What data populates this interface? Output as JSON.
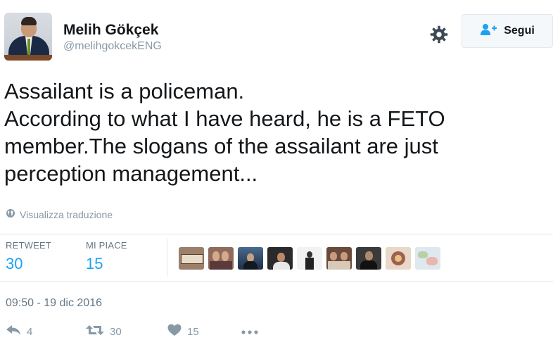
{
  "header": {
    "display_name": "Melih Gökçek",
    "handle": "@melihgokcekENG",
    "follow_label": "Segui"
  },
  "tweet": {
    "lines": [
      "Assailant is a policeman.",
      "According to what I have heard, he is a FETO",
      "member.The slogans of the assailant are just",
      "perception management..."
    ],
    "translate_label": "Visualizza traduzione"
  },
  "stats": {
    "retweets_label": "RETWEET",
    "retweets_value": "30",
    "likes_label": "MI PIACE",
    "likes_value": "15"
  },
  "timestamp": "09:50 - 19 dic 2016",
  "actions": {
    "reply_count": "4",
    "retweet_count": "30",
    "like_count": "15"
  },
  "icons": {
    "settings": "gear-icon",
    "follow": "add-user-icon",
    "translate": "globe-icon",
    "reply": "reply-icon",
    "retweet": "retweet-icon",
    "like": "heart-icon",
    "more": "more-icon"
  },
  "colors": {
    "accent": "#1da1f2",
    "muted": "#8899a6",
    "text": "#14171a",
    "border": "#e1e8ed"
  }
}
